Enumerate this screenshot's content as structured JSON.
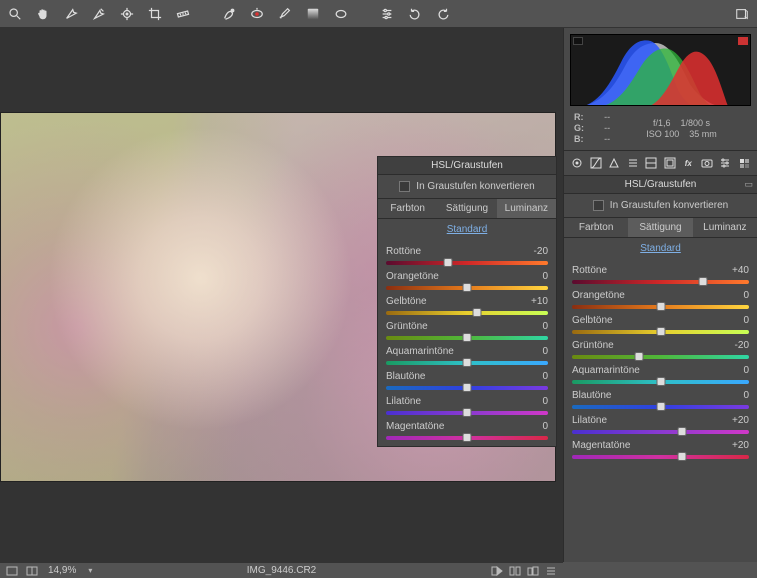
{
  "meta": {
    "rgb_labels": [
      "R:",
      "G:",
      "B:"
    ],
    "rgb_values": [
      "--",
      "--",
      "--"
    ],
    "aperture": "f/1,6",
    "shutter": "1/800 s",
    "iso_label": "ISO",
    "iso_value": "100",
    "focal": "35 mm"
  },
  "hsl": {
    "title": "HSL/Graustufen",
    "grayscale_label": "In Graustufen konvertieren",
    "tabs": {
      "hue": "Farbton",
      "saturation": "Sättigung",
      "luminance": "Luminanz"
    },
    "preset": "Standard",
    "labels": {
      "red": "Rottöne",
      "orange": "Orangetöne",
      "yellow": "Gelbtöne",
      "green": "Grüntöne",
      "aqua": "Aquamarintöne",
      "blue": "Blautöne",
      "purple": "Lilatöne",
      "magenta": "Magentatöne"
    }
  },
  "float_panel": {
    "active_tab": "luminance",
    "values": {
      "red": "-20",
      "orange": "0",
      "yellow": "+10",
      "green": "0",
      "aqua": "0",
      "blue": "0",
      "purple": "0",
      "magenta": "0"
    },
    "positions": {
      "red": 38,
      "orange": 50,
      "yellow": 56,
      "green": 50,
      "aqua": 50,
      "blue": 50,
      "purple": 50,
      "magenta": 50
    }
  },
  "side_panel": {
    "active_tab": "saturation",
    "values": {
      "red": "+40",
      "orange": "0",
      "yellow": "0",
      "green": "-20",
      "aqua": "0",
      "blue": "0",
      "purple": "+20",
      "magenta": "+20"
    },
    "positions": {
      "red": 74,
      "orange": 50,
      "yellow": 50,
      "green": 38,
      "aqua": 50,
      "blue": 50,
      "purple": 62,
      "magenta": 62
    }
  },
  "status": {
    "zoom": "14,9%",
    "filename": "IMG_9446.CR2"
  }
}
